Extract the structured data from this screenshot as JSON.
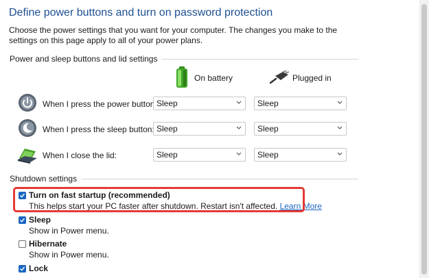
{
  "page": {
    "title": "Define power buttons and turn on password protection",
    "description": "Choose the power settings that you want for your computer. The changes you make to the settings on this page apply to all of your power plans."
  },
  "power_section": {
    "label": "Power and sleep buttons and lid settings",
    "col_battery": "On battery",
    "col_plugged": "Plugged in",
    "rows": [
      {
        "label": "When I press the power button:",
        "battery": "Sleep",
        "plugged": "Sleep",
        "icon": "power-button-icon"
      },
      {
        "label": "When I press the sleep button:",
        "battery": "Sleep",
        "plugged": "Sleep",
        "icon": "sleep-button-icon"
      },
      {
        "label": "When I close the lid:",
        "battery": "Sleep",
        "plugged": "Sleep",
        "icon": "laptop-lid-icon"
      }
    ]
  },
  "shutdown_section": {
    "label": "Shutdown settings",
    "options": [
      {
        "label": "Turn on fast startup (recommended)",
        "checked": true,
        "desc": "This helps start your PC faster after shutdown. Restart isn't affected.",
        "link": "Learn More"
      },
      {
        "label": "Sleep",
        "checked": true,
        "desc": "Show in Power menu."
      },
      {
        "label": "Hibernate",
        "checked": false,
        "desc": "Show in Power menu."
      },
      {
        "label": "Lock",
        "checked": true
      }
    ]
  },
  "colors": {
    "title": "#1d4f91",
    "accent": "#1a66c4",
    "highlight": "#e53935"
  }
}
